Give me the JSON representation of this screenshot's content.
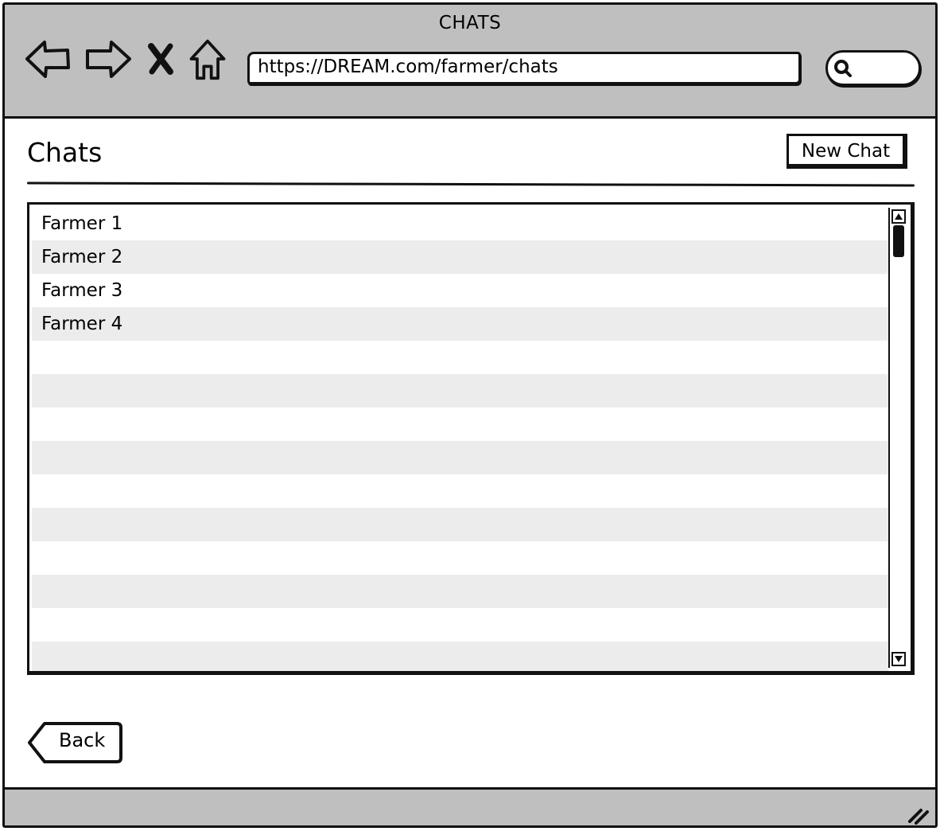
{
  "window": {
    "title": "CHATS"
  },
  "toolbar": {
    "back_icon": "arrow-left-icon",
    "forward_icon": "arrow-right-icon",
    "stop_icon": "close-icon",
    "home_icon": "home-icon",
    "url": "https://DREAM.com/farmer/chats",
    "search_icon": "search-icon"
  },
  "page": {
    "title": "Chats",
    "new_chat_label": "New Chat",
    "back_label": "Back"
  },
  "chat_list": {
    "items": [
      {
        "label": "Farmer 1"
      },
      {
        "label": "Farmer 2"
      },
      {
        "label": "Farmer 3"
      },
      {
        "label": "Farmer 4"
      },
      {
        "label": ""
      },
      {
        "label": ""
      },
      {
        "label": ""
      },
      {
        "label": ""
      },
      {
        "label": ""
      },
      {
        "label": ""
      },
      {
        "label": ""
      },
      {
        "label": ""
      },
      {
        "label": ""
      },
      {
        "label": ""
      }
    ]
  },
  "colors": {
    "chrome_bg": "#bfbfbf",
    "row_alt_bg": "#ececec",
    "stroke": "#111111"
  }
}
